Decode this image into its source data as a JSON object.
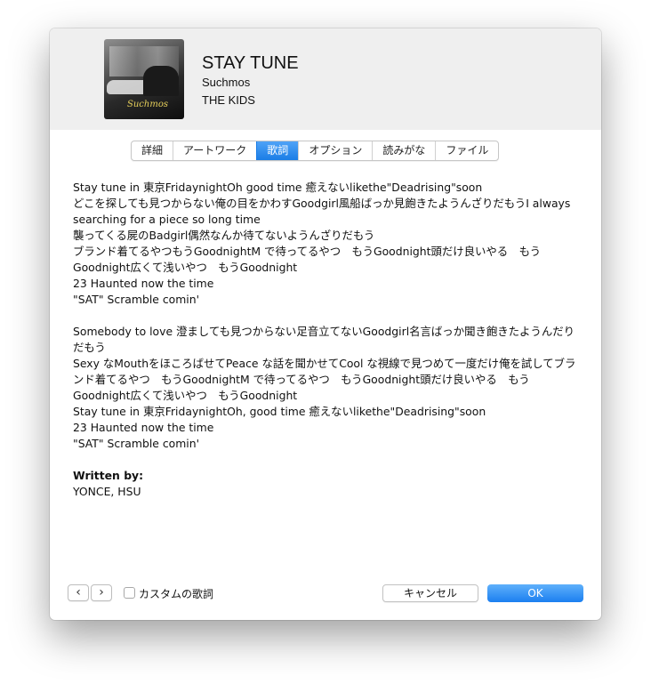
{
  "header": {
    "title": "STAY TUNE",
    "artist": "Suchmos",
    "album": "THE KIDS",
    "artwork_logo": "Suchmos"
  },
  "tabs": [
    {
      "label": "詳細",
      "active": false
    },
    {
      "label": "アートワーク",
      "active": false
    },
    {
      "label": "歌詞",
      "active": true
    },
    {
      "label": "オプション",
      "active": false
    },
    {
      "label": "読みがな",
      "active": false
    },
    {
      "label": "ファイル",
      "active": false
    }
  ],
  "lyrics": {
    "lines": [
      "Stay tune in 東京FridaynightOh good time 癒えないlikethe\"Deadrising\"soon",
      "どこを探しても見つからない俺の目をかわすGoodgirl風船ばっか見飽きたようんざりだもうI always searching for a piece so long time",
      "襲ってくる屍のBadgirl偶然なんか待てないようんざりだもう",
      "ブランド着てるやつもうGoodnightM で待ってるやつ　もうGoodnight頭だけ良いやる　もうGoodnight広くて浅いやつ　もうGoodnight",
      "23 Haunted now the time",
      "\"SAT\" Scramble comin'",
      "",
      "Somebody to love 澄ましても見つからない足音立てないGoodgirl名言ばっか聞き飽きたようんだりだもう",
      "Sexy なMouthをほころばせてPeace な話を聞かせてCool な視線で見つめて一度だけ俺を試してブランド着てるやつ　もうGoodnightM で待ってるやつ　もうGoodnight頭だけ良いやる　もうGoodnight広くて浅いやつ　もうGoodnight",
      "Stay tune in 東京FridaynightOh, good time 癒えないlikethe\"Deadrising\"soon",
      "23 Haunted now the time",
      "\"SAT\" Scramble comin'"
    ],
    "written_by_label": "Written by:",
    "written_by": "YONCE, HSU"
  },
  "footer": {
    "prev_symbol": "‹",
    "next_symbol": "›",
    "custom_lyrics_label": "カスタムの歌詞",
    "custom_lyrics_checked": false,
    "cancel_label": "キャンセル",
    "ok_label": "OK"
  }
}
